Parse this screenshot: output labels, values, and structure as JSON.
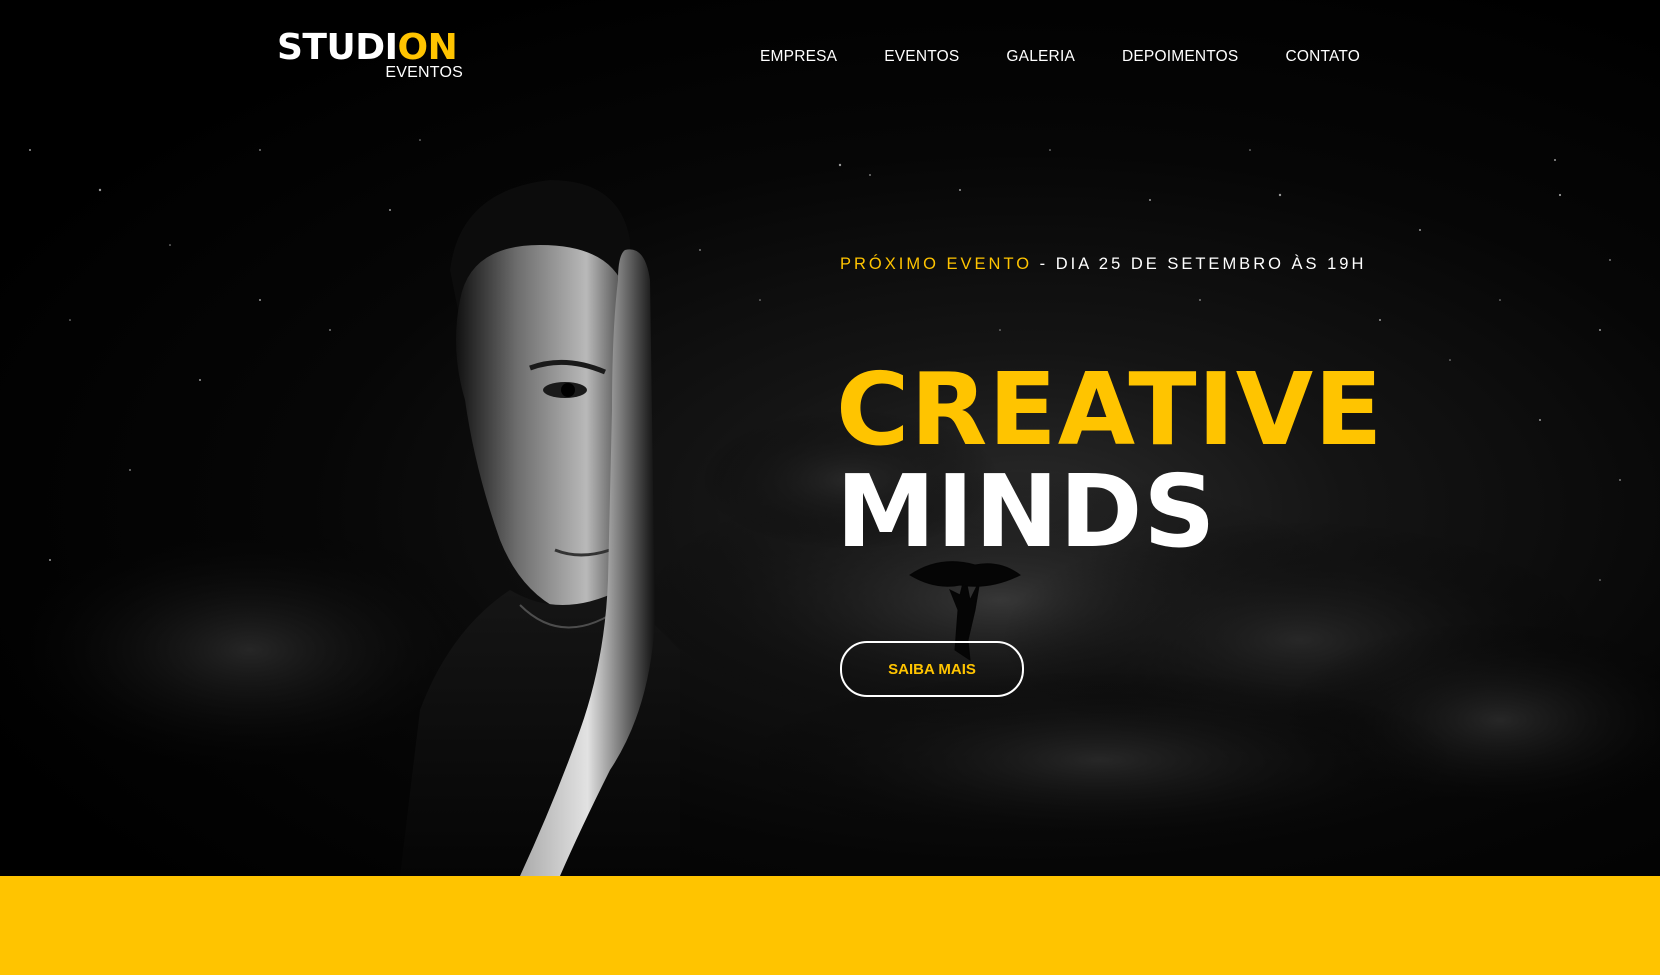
{
  "brand": {
    "logo_part1": "STUDI",
    "logo_part2": "ON",
    "logo_sub": "EVENTOS",
    "accent_color": "#ffc400"
  },
  "nav": {
    "items": [
      {
        "label": "EMPRESA"
      },
      {
        "label": "EVENTOS"
      },
      {
        "label": "GALERIA"
      },
      {
        "label": "DEPOIMENTOS"
      },
      {
        "label": "CONTATO"
      }
    ]
  },
  "hero": {
    "eyebrow_highlight": "PRÓXIMO EVENTO",
    "eyebrow_rest": " - DIA 25 DE SETEMBRO ÀS 19H",
    "title_line1": "CREATIVE",
    "title_line2": "MINDS",
    "cta_label": "SAIBA MAIS"
  }
}
